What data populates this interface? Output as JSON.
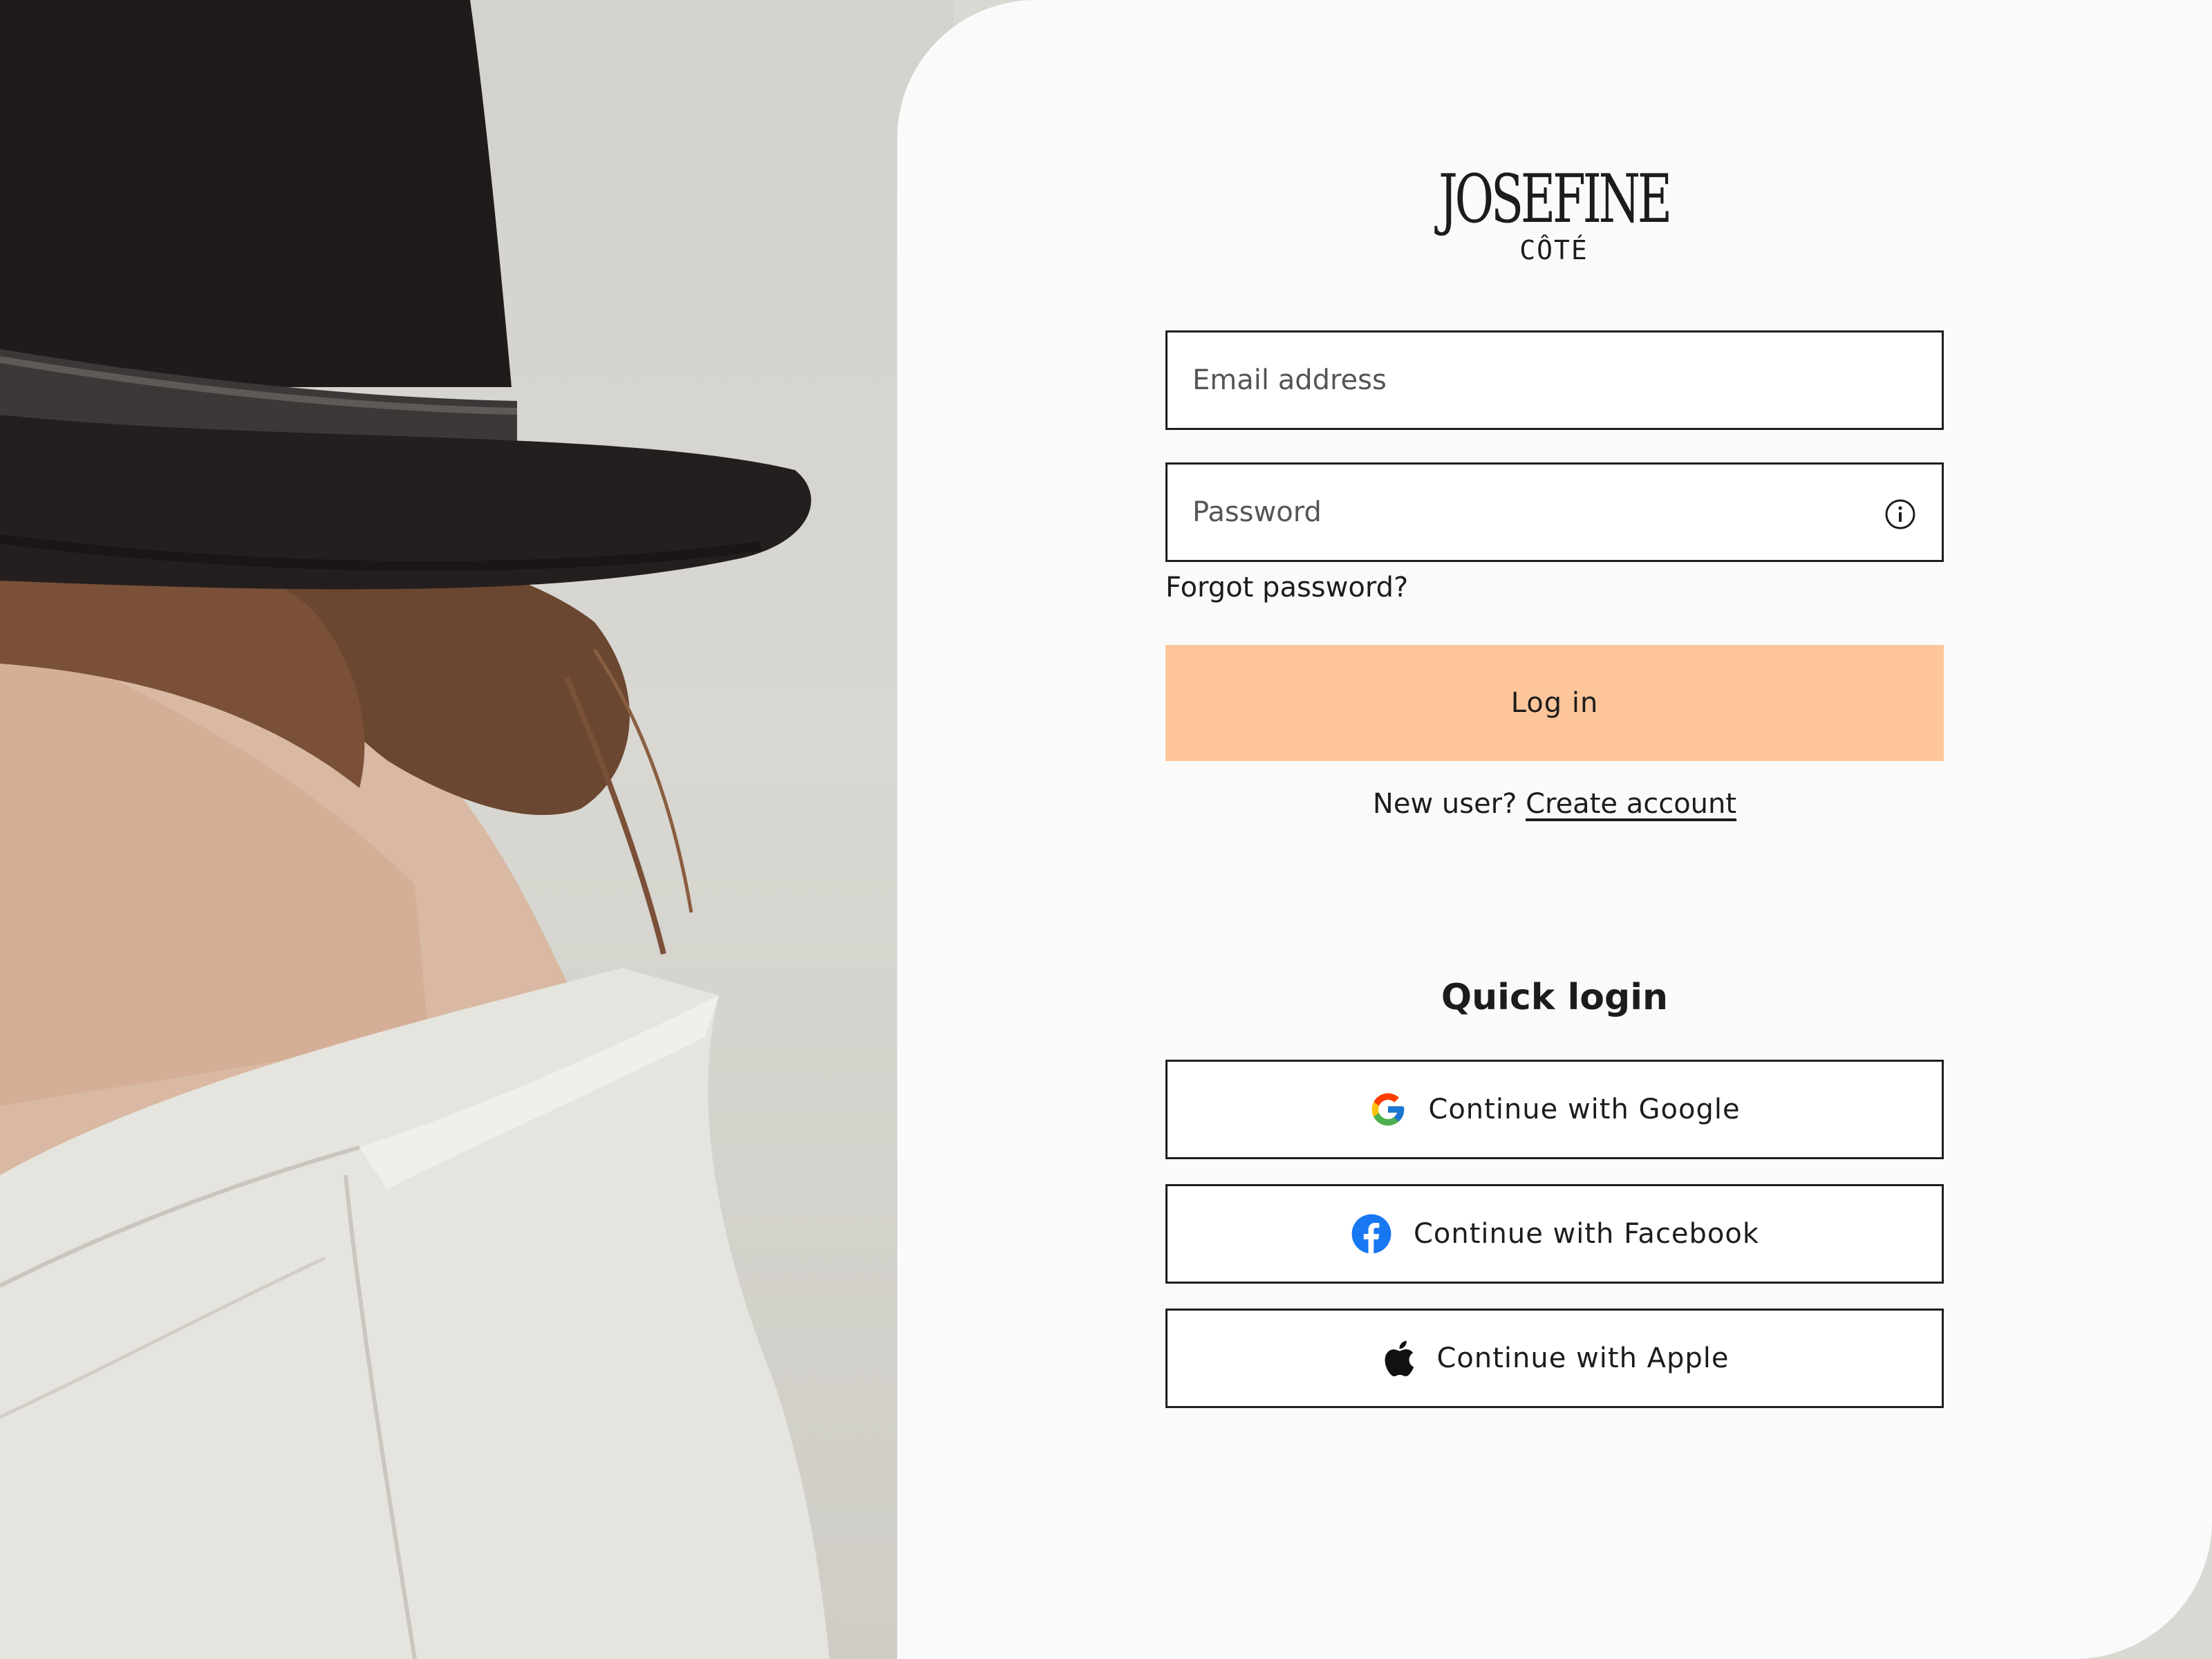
{
  "brand": {
    "logo_main": "JOSEFINE",
    "logo_sub": "CÔTÉ"
  },
  "form": {
    "email_placeholder": "Email address",
    "email_value": "",
    "password_placeholder": "Password",
    "password_value": "",
    "forgot_label": "Forgot password?",
    "login_label": "Log in",
    "new_user_text": "New user?",
    "create_account_label": "Create account"
  },
  "quick_login": {
    "title": "Quick login",
    "google_label": "Continue with Google",
    "facebook_label": "Continue with Facebook",
    "apple_label": "Continue with Apple"
  },
  "icons": {
    "info": "info-icon",
    "google": "google-icon",
    "facebook": "facebook-icon",
    "apple": "apple-icon"
  },
  "colors": {
    "accent": "#ffc59a",
    "panel_background": "#fafafa",
    "text": "#1c1c1c",
    "border": "#1e1e1e",
    "facebook_blue": "#1877f2"
  }
}
